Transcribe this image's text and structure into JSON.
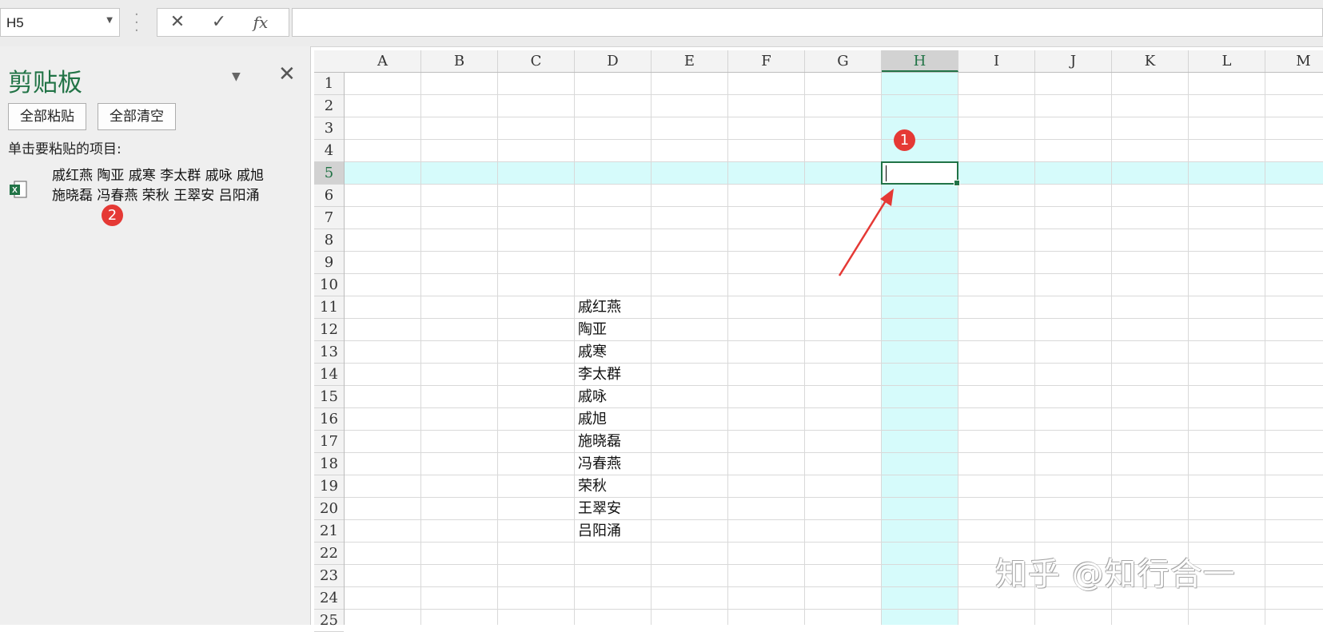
{
  "formula_bar": {
    "name_box": "H5",
    "cancel_icon": "✕",
    "enter_icon": "✓",
    "fx_icon": "fx",
    "formula": ""
  },
  "clipboard": {
    "title": "剪贴板",
    "paste_all": "全部粘贴",
    "clear_all": "全部清空",
    "instruction": "单击要粘贴的项目:",
    "item_text": "戚红燕 陶亚 戚寒 李太群 戚咏 戚旭 施晓磊 冯春燕 荣秋 王翠安 吕阳涌"
  },
  "markers": {
    "m1": "1",
    "m2": "2"
  },
  "columns": [
    "A",
    "B",
    "C",
    "D",
    "E",
    "F",
    "G",
    "H",
    "I",
    "J",
    "K",
    "L",
    "M"
  ],
  "rows": [
    "1",
    "2",
    "3",
    "4",
    "5",
    "6",
    "7",
    "8",
    "9",
    "10",
    "11",
    "12",
    "13",
    "14",
    "15",
    "16",
    "17",
    "18",
    "19",
    "20",
    "21",
    "22",
    "23",
    "24",
    "25"
  ],
  "cell_values": {
    "D11": "戚红燕",
    "D12": "陶亚",
    "D13": "戚寒",
    "D14": "李太群",
    "D15": "戚咏",
    "D16": "戚旭",
    "D17": "施晓磊",
    "D18": "冯春燕",
    "D19": "荣秋",
    "D20": "王翠安",
    "D21": "吕阳涌"
  },
  "active_cell": {
    "column": "H",
    "row": "5"
  },
  "watermark": "知乎 @知行合一",
  "colors": {
    "excel_green": "#217346",
    "highlight": "#d6fbfb",
    "marker_red": "#e53935"
  }
}
